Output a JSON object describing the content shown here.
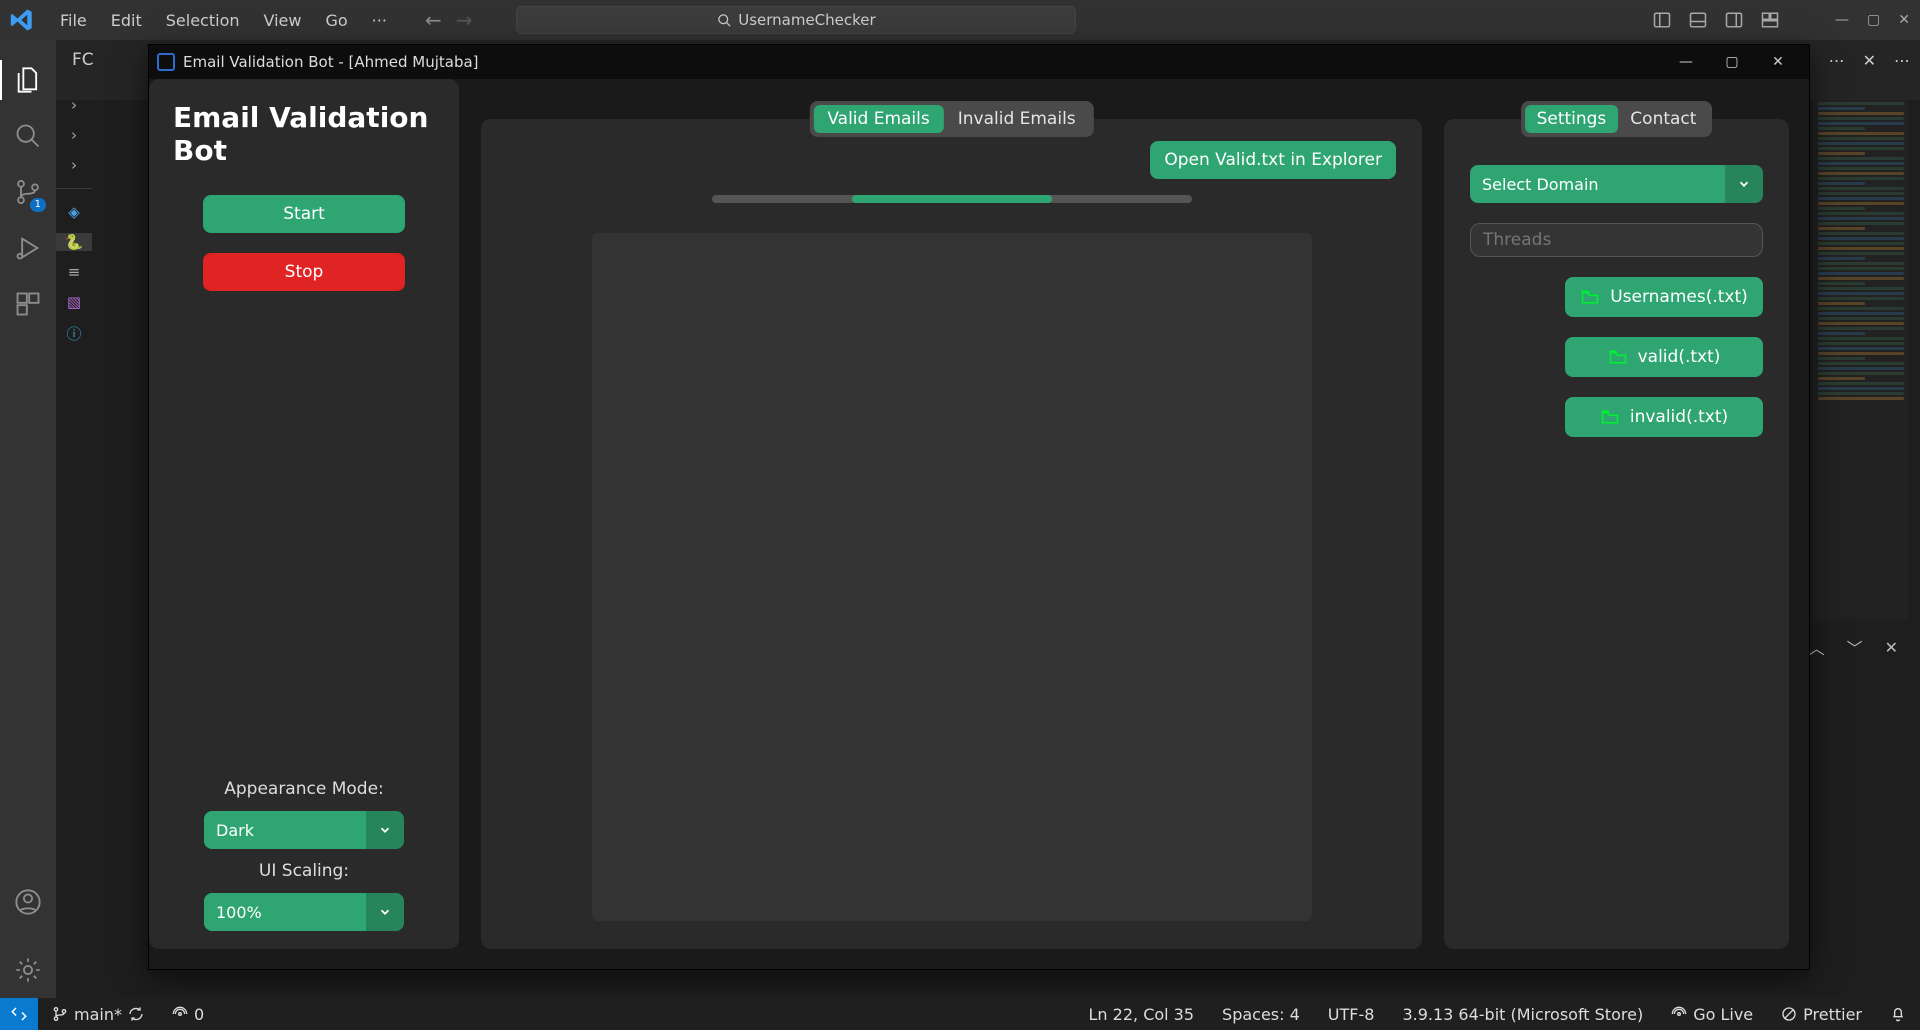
{
  "vscode": {
    "menu": [
      "File",
      "Edit",
      "Selection",
      "View",
      "Go",
      "···"
    ],
    "search_text": "UsernameChecker",
    "explorer_tab": "FC",
    "tab_actions_close": "✕",
    "activity_badge": "1",
    "status": {
      "branch": "main*",
      "ports": "0",
      "cursor": "Ln 22, Col 35",
      "spaces": "Spaces: 4",
      "encoding": "UTF-8",
      "python": "3.9.13 64-bit (Microsoft Store)",
      "golive": "Go Live",
      "prettier": "Prettier"
    }
  },
  "dialog": {
    "title": "Email Validation Bot - [Ahmed Mujtaba]",
    "heading": "Email Validation Bot",
    "start_label": "Start",
    "stop_label": "Stop",
    "appearance_label": "Appearance Mode:",
    "appearance_value": "Dark",
    "scaling_label": "UI Scaling:",
    "scaling_value": "100%",
    "tabs": {
      "valid": "Valid Emails",
      "invalid": "Invalid Emails"
    },
    "open_valid_label": "Open Valid.txt in Explorer",
    "right_tabs": {
      "settings": "Settings",
      "contact": "Contact"
    },
    "domain_label": "Select Domain",
    "threads_placeholder": "Threads",
    "file_buttons": {
      "usernames": "Usernames(.txt)",
      "valid": "valid(.txt)",
      "invalid": "invalid(.txt)"
    }
  }
}
